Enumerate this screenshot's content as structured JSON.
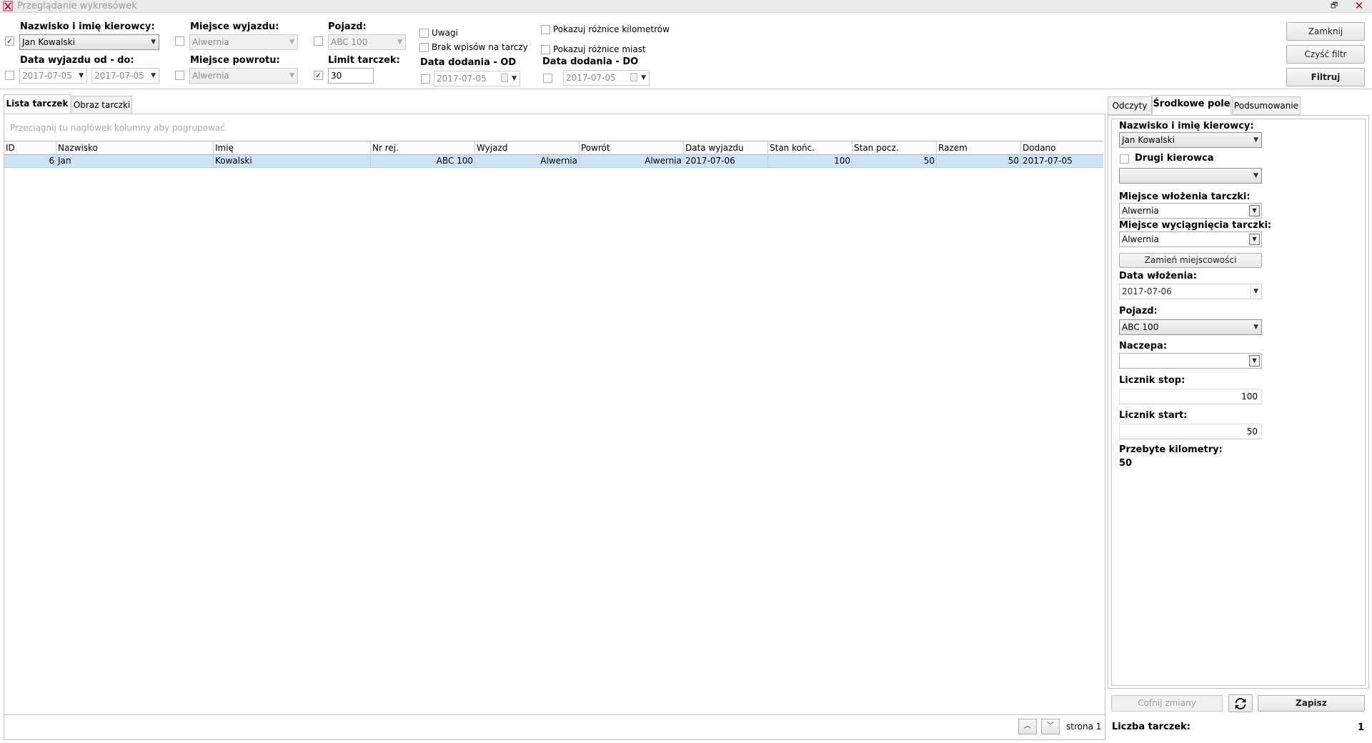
{
  "window": {
    "title": "Przeglądanie wykresówek",
    "restore_glyph": "🗗",
    "close_glyph": "✕"
  },
  "filters": {
    "driver": {
      "label": "Nazwisko i imię kierowcy:",
      "value": "Jan Kowalski",
      "checked": true
    },
    "date_range": {
      "label": "Data wyjazdu od - do:",
      "from": "2017-07-05",
      "to": "2017-07-05",
      "checked": false
    },
    "departure_place": {
      "label": "Miejsce wyjazdu:",
      "value": "Alwernia",
      "checked": false
    },
    "return_place": {
      "label": "Miejsce powrotu:",
      "value": "Alwernia",
      "checked": false
    },
    "vehicle": {
      "label": "Pojazd:",
      "value": "ABC 100",
      "checked": false
    },
    "limit": {
      "label": "Limit tarczek:",
      "value": "30",
      "checked": true
    },
    "remarks": {
      "label": "Uwagi",
      "checked": false
    },
    "no_entries": {
      "label": "Brak wpisów na tarczy",
      "checked": false
    },
    "date_added_from": {
      "label": "Data dodania - OD",
      "value": "2017-07-05",
      "checked": false
    },
    "show_km_diff": {
      "label": "Pokazuj różnice kilometrów",
      "checked": false
    },
    "show_city_diff": {
      "label": "Pokazuj różnice miast",
      "checked": false
    },
    "date_added_to": {
      "label": "Data dodania - DO",
      "value": "2017-07-05",
      "checked": false
    },
    "check_mark": "✓"
  },
  "actions": {
    "close": "Zamknij",
    "clear_filter": "Czyść filtr",
    "filter": "Filtruj"
  },
  "left_tabs": [
    "Lista tarczek",
    "Obraz tarczki"
  ],
  "grid": {
    "group_hint": "Przeciągnij tu nagłówek kolumny aby pogrupować",
    "columns": [
      "ID",
      "Nazwisko",
      "Imię",
      "Nr rej.",
      "Wyjazd",
      "Powrót",
      "Data wyjazdu",
      "Stan końc.",
      "Stan pocz.",
      "Razem",
      "Dodano"
    ],
    "rows": [
      {
        "id": "6",
        "nazwisko": "Jan",
        "imie": "Kowalski",
        "nr_rej": "ABC 100",
        "wyjazd": "Alwernia",
        "powrot": "Alwernia",
        "data_wyjazdu": "2017-07-06",
        "stan_konc": "100",
        "stan_pocz": "50",
        "razem": "50",
        "dodano": "2017-07-05"
      }
    ],
    "page_label": "strona 1",
    "up_glyph": "︿",
    "down_glyph": "﹀"
  },
  "right_tabs": [
    "Odczyty",
    "Środkowe pole",
    "Podsumowanie"
  ],
  "detail": {
    "driver_label": "Nazwisko i imię kierowcy:",
    "driver_value": "Jan Kowalski",
    "second_driver_label": "Drugi kierowca",
    "second_driver_value": "",
    "insert_place_label": "Miejsce włożenia tarczki:",
    "insert_place_value": "Alwernia",
    "remove_place_label": "Miejsce wyciągnięcia tarczki:",
    "remove_place_value": "Alwernia",
    "swap_button": "Zamień miejscowości",
    "insert_date_label": "Data włożenia:",
    "insert_date_value": "2017-07-06",
    "vehicle_label": "Pojazd:",
    "vehicle_value": "ABC 100",
    "trailer_label": "Naczepa:",
    "trailer_value": "",
    "counter_stop_label": "Licznik stop:",
    "counter_stop_value": "100",
    "counter_start_label": "Licznik start:",
    "counter_start_value": "50",
    "km_label": "Przebyte kilometry:",
    "km_value": "50"
  },
  "bottom": {
    "undo": "Cofnij zmiany",
    "save": "Zapisz",
    "count_label": "Liczba tarczek:",
    "count_value": "1"
  }
}
